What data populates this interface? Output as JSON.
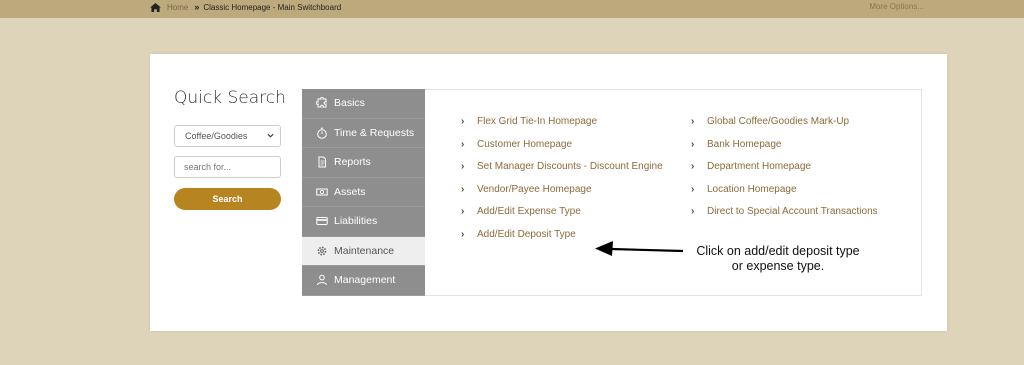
{
  "breadcrumb": {
    "home": "Home",
    "current": "Classic Homepage - Main Switchboard"
  },
  "more_options": "More Options...",
  "quick_search": {
    "title": "Quick Search",
    "selected_category": "Coffee/Goodies",
    "search_placeholder": "search for...",
    "search_button": "Search"
  },
  "menu": [
    {
      "label": "Basics",
      "icon": "puzzle-icon"
    },
    {
      "label": "Time & Requests",
      "icon": "stopwatch-icon"
    },
    {
      "label": "Reports",
      "icon": "document-icon"
    },
    {
      "label": "Assets",
      "icon": "money-icon"
    },
    {
      "label": "Liabilities",
      "icon": "credit-card-icon"
    },
    {
      "label": "Maintenance",
      "icon": "gear-icon",
      "active": true
    },
    {
      "label": "Management",
      "icon": "user-icon"
    }
  ],
  "links_col1": [
    "Flex Grid Tie-In Homepage",
    "Customer Homepage",
    "Set Manager Discounts - Discount Engine",
    "Vendor/Payee Homepage",
    "Add/Edit Expense Type",
    "Add/Edit Deposit Type"
  ],
  "links_col2": [
    "Global Coffee/Goodies Mark-Up",
    "Bank Homepage",
    "Department Homepage",
    "Location Homepage",
    "Direct to Special Account Transactions"
  ],
  "annotation": "Click on add/edit deposit type or expense type.",
  "colors": {
    "topbar": "#bcaa7c",
    "background": "#ddd4b9",
    "accent": "#b78520",
    "menu": "#8e8e8e",
    "link": "#8c6b3a"
  }
}
